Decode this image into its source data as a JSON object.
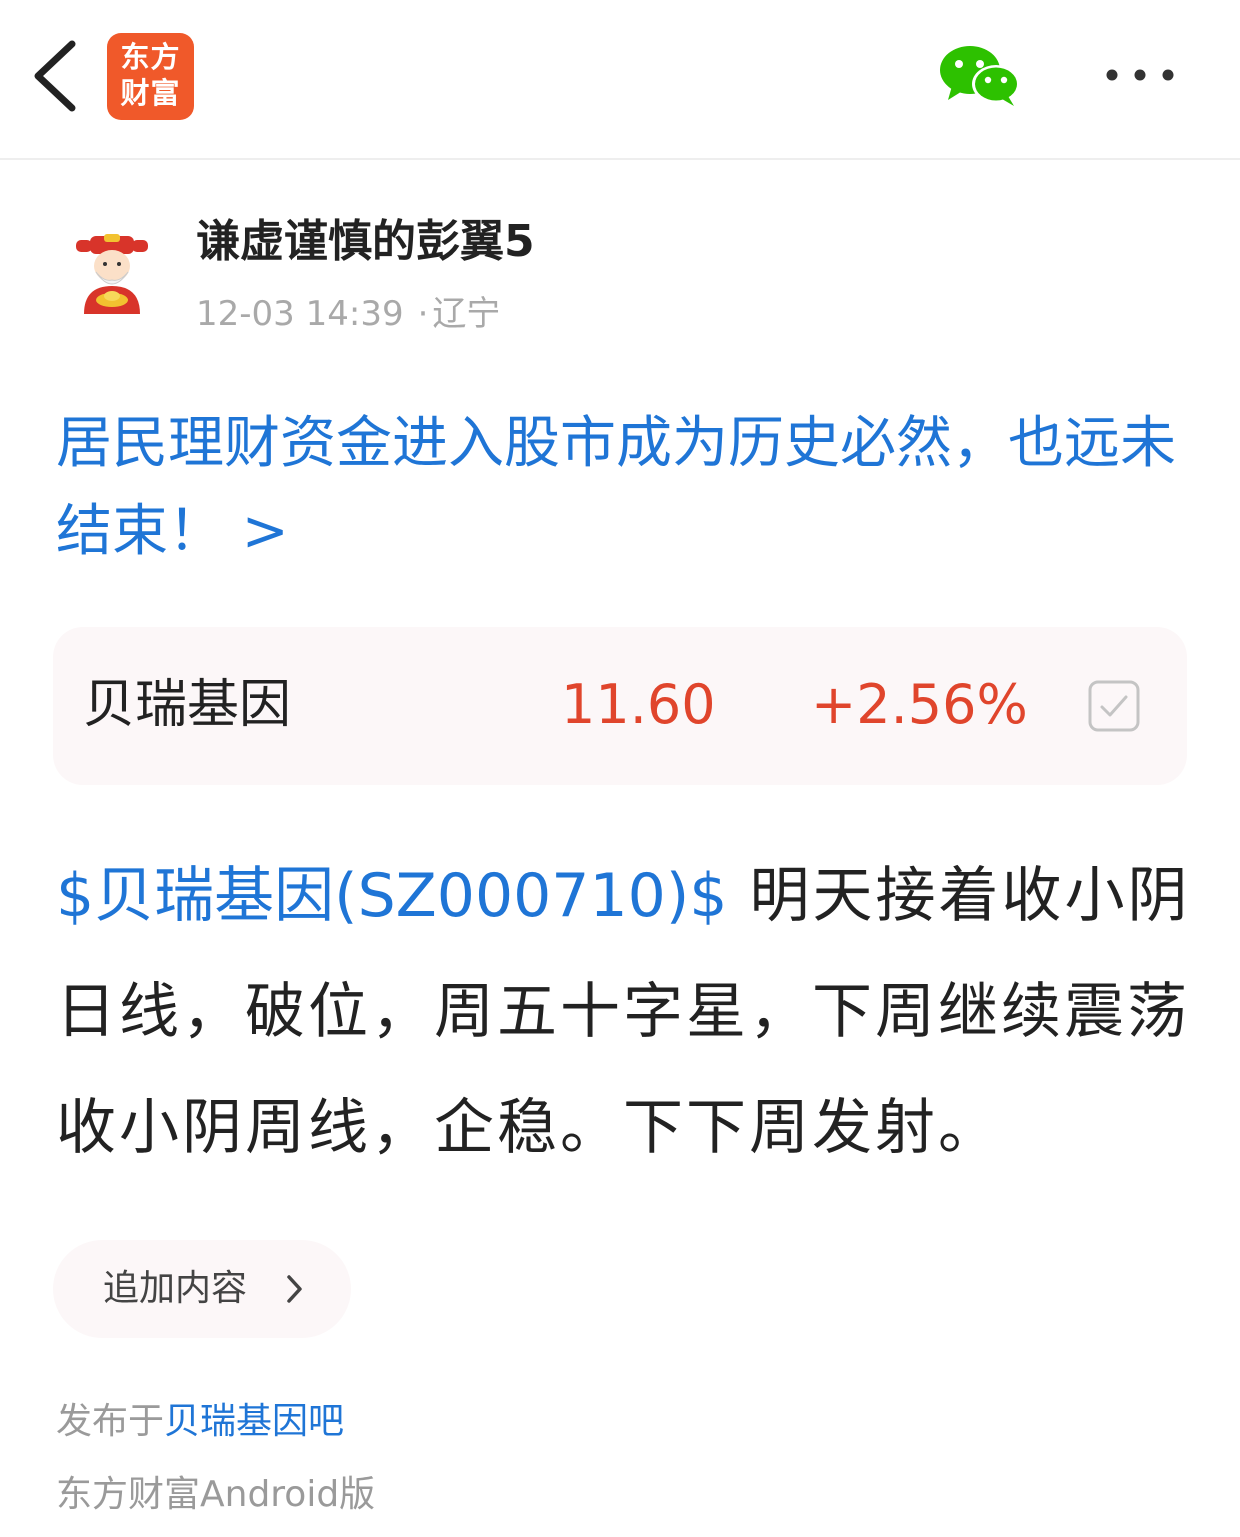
{
  "header": {
    "back_icon": "chevron-left-icon",
    "logo": {
      "line1": "东方",
      "line2": "财富",
      "color": "#f0592a"
    },
    "share_icon": "wechat-icon",
    "more_icon": "more-dots-icon"
  },
  "author": {
    "avatar_icon": "god-of-wealth-avatar",
    "name": "谦虚谨慎的彭翼5",
    "timestamp": "12-03 14:39",
    "separator": "·",
    "location": "辽宁"
  },
  "headline": {
    "text": "居民理财资金进入股市成为历史必然，也远未结束！ >",
    "color": "#1f75d6"
  },
  "stock_card": {
    "name": "贝瑞基因",
    "price": "11.60",
    "change": "+2.56%",
    "price_color": "#e0452c",
    "checkbox_icon": "checkbox-checked-icon"
  },
  "post": {
    "stock_link": "$贝瑞基因(SZ000710)$",
    "text": " 明天接着收小阴日线，破位，周五十字星，下周继续震荡收小阴周线，企稳。下下周发射。"
  },
  "add_content": {
    "label": "追加内容",
    "icon": "chevron-right-icon"
  },
  "footer": {
    "published_prefix": "发布于",
    "bar_name": "贝瑞基因吧",
    "client": "东方财富Android版"
  },
  "colors": {
    "link": "#1f75d6",
    "up": "#e0452c",
    "card_bg": "#fcf7f8",
    "meta_text": "#a9a9a9"
  }
}
